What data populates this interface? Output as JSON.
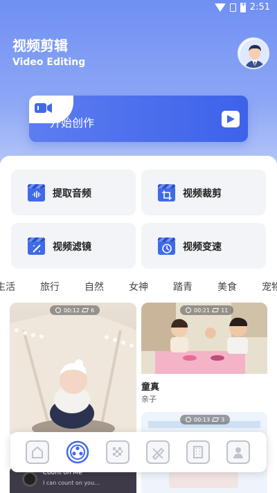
{
  "status_bar": {
    "time": "2:51"
  },
  "header": {
    "title_cn": "视频剪辑",
    "title_en": "Video Editing"
  },
  "create": {
    "label": "开始创作"
  },
  "tools": [
    {
      "label": "提取音频",
      "icon": "audio-wave-icon"
    },
    {
      "label": "视频裁剪",
      "icon": "crop-icon"
    },
    {
      "label": "视频滤镜",
      "icon": "wand-icon"
    },
    {
      "label": "视频变速",
      "icon": "speed-icon"
    }
  ],
  "categories": [
    "生活",
    "旅行",
    "自然",
    "女神",
    "踏青",
    "美食",
    "宠物"
  ],
  "templates": [
    {
      "duration": "00:12",
      "layers": "6"
    },
    {
      "duration": "00:21",
      "layers": "11",
      "title": "童真",
      "tag": "亲子"
    },
    {
      "duration": "00:13",
      "layers": "3"
    }
  ],
  "music_card": {
    "title": "Count on Me",
    "subtitle": "I can count on you..."
  },
  "nav": [
    {
      "name": "home",
      "active": false
    },
    {
      "name": "template",
      "active": true
    },
    {
      "name": "mosaic",
      "active": false
    },
    {
      "name": "edit",
      "active": false
    },
    {
      "name": "film",
      "active": false
    },
    {
      "name": "profile",
      "active": false
    }
  ],
  "colors": {
    "accent": "#3f6ae8",
    "hero": "#6f8ff2"
  }
}
